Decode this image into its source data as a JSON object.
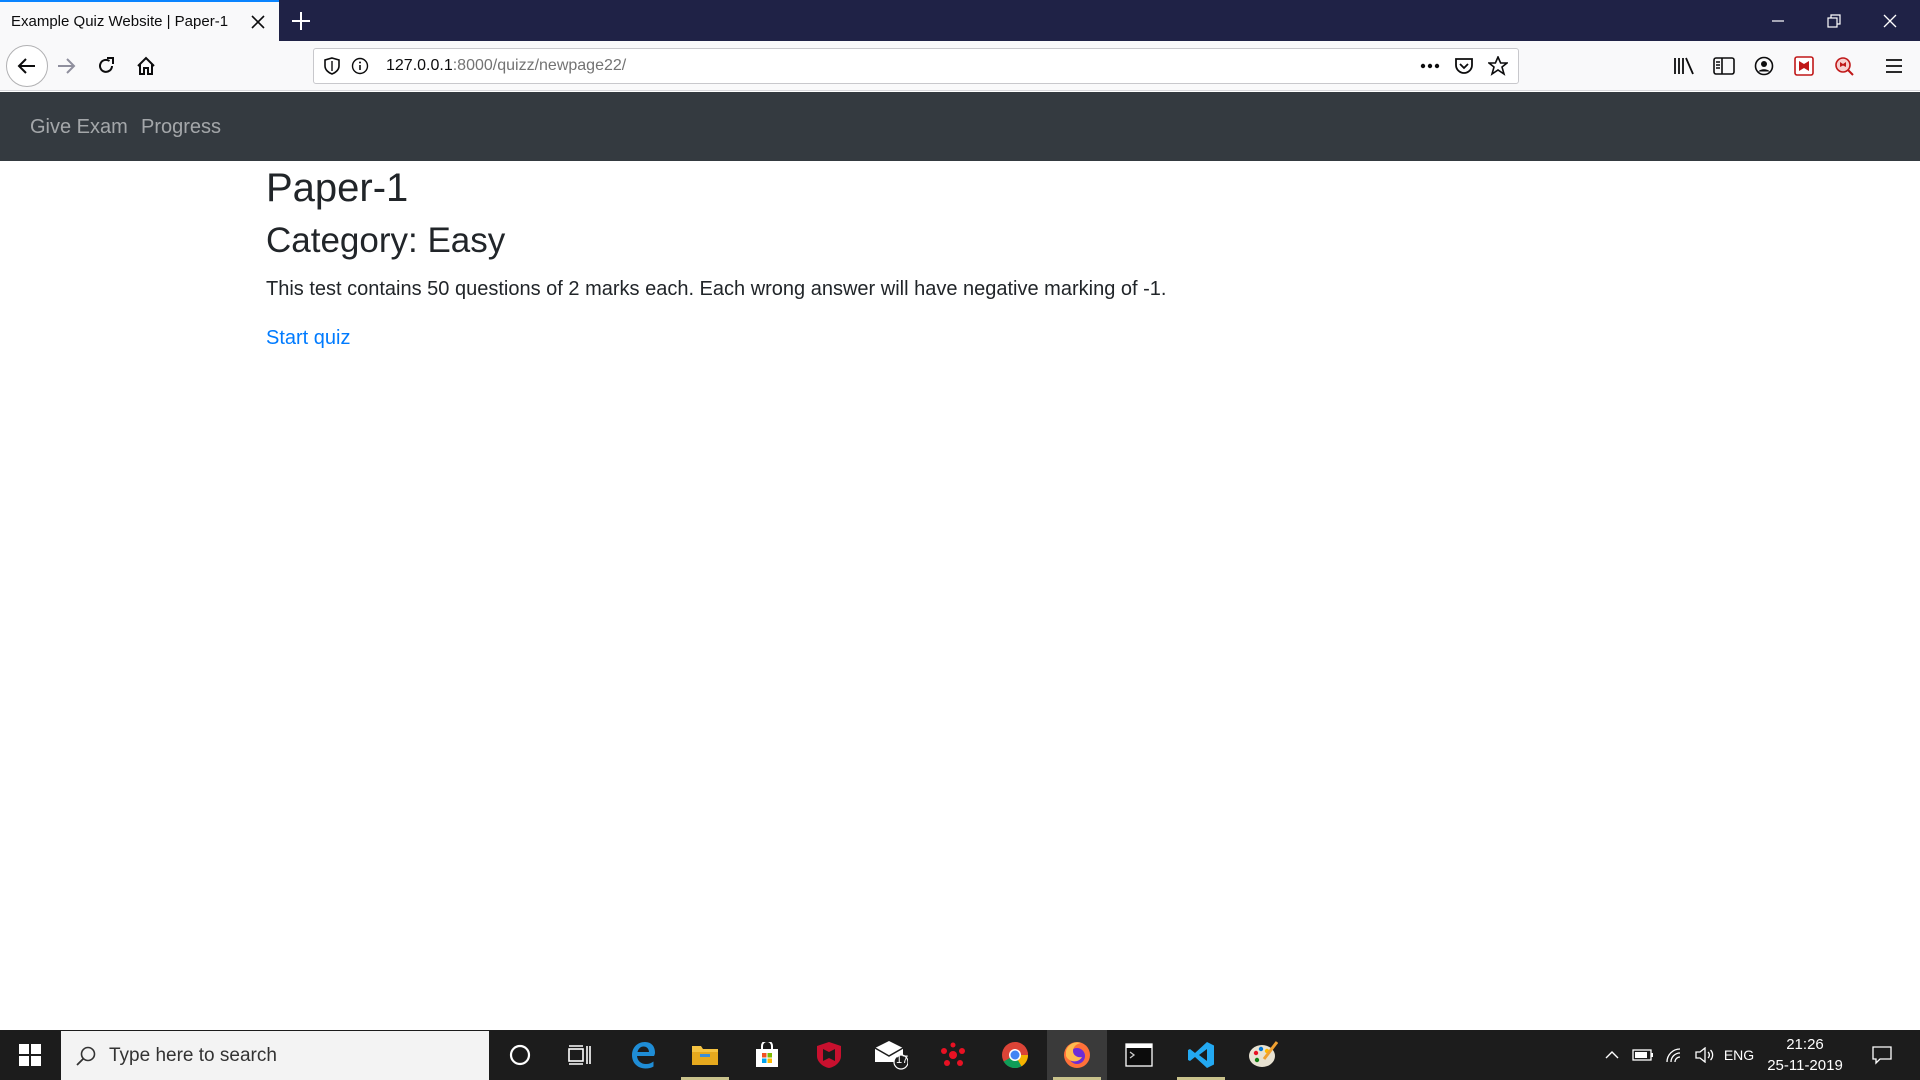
{
  "browser": {
    "tab_title": "Example Quiz Website | Paper-1",
    "url_host": "127.0.0.1",
    "url_rest": ":8000/quizz/newpage22/"
  },
  "navbar": {
    "links": [
      "Give Exam",
      "Progress"
    ]
  },
  "page": {
    "title": "Paper-1",
    "category": "Category: Easy",
    "description": "This test contains 50 questions of 2 marks each. Each wrong answer will have negative marking of -1.",
    "start_link": "Start quiz"
  },
  "taskbar": {
    "search_placeholder": "Type here to search",
    "mail_badge": "17",
    "language": "ENG",
    "time": "21:26",
    "date": "25-11-2019",
    "apps": [
      "cortana-icon",
      "task-view-icon",
      "edge-icon",
      "file-explorer-icon",
      "store-icon",
      "mcafee-icon",
      "mail-icon",
      "cluster-app-icon",
      "chrome-icon",
      "firefox-icon",
      "terminal-icon",
      "vscode-icon",
      "paint-icon"
    ]
  },
  "colors": {
    "navbar": "#343a40",
    "link": "#007bff",
    "tabstrip": "#1f2246",
    "taskbar": "#1c1c1c"
  }
}
